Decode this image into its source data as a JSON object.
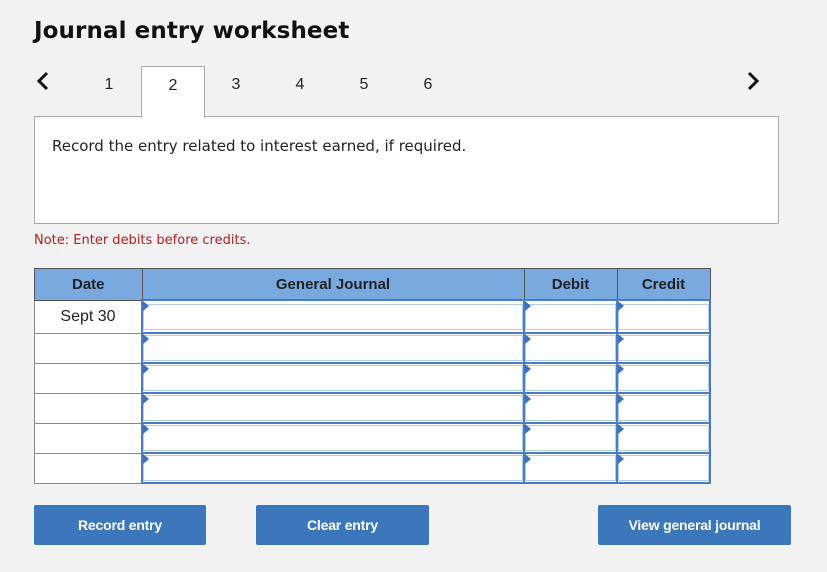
{
  "header": {
    "title": "Journal entry worksheet"
  },
  "nav": {
    "prev_icon": "‹",
    "next_icon": "›",
    "tabs": [
      {
        "label": "1",
        "active": false
      },
      {
        "label": "2",
        "active": true
      },
      {
        "label": "3",
        "active": false
      },
      {
        "label": "4",
        "active": false
      },
      {
        "label": "5",
        "active": false
      },
      {
        "label": "6",
        "active": false
      }
    ]
  },
  "prompt": {
    "text": "Record the entry related to interest earned, if required."
  },
  "note": "Note: Enter debits before credits.",
  "journal": {
    "headers": {
      "date": "Date",
      "account": "General Journal",
      "debit": "Debit",
      "credit": "Credit"
    },
    "rows": [
      {
        "date": "Sept 30",
        "account": "",
        "debit": "",
        "credit": ""
      },
      {
        "date": "",
        "account": "",
        "debit": "",
        "credit": ""
      },
      {
        "date": "",
        "account": "",
        "debit": "",
        "credit": ""
      },
      {
        "date": "",
        "account": "",
        "debit": "",
        "credit": ""
      },
      {
        "date": "",
        "account": "",
        "debit": "",
        "credit": ""
      },
      {
        "date": "",
        "account": "",
        "debit": "",
        "credit": ""
      }
    ]
  },
  "buttons": {
    "record": "Record entry",
    "clear": "Clear entry",
    "view": "View general journal"
  },
  "colors": {
    "header_bg": "#7aa9e0",
    "button_bg": "#3c77bb",
    "note_text": "#b02020",
    "input_border": "#4a7cc0"
  }
}
